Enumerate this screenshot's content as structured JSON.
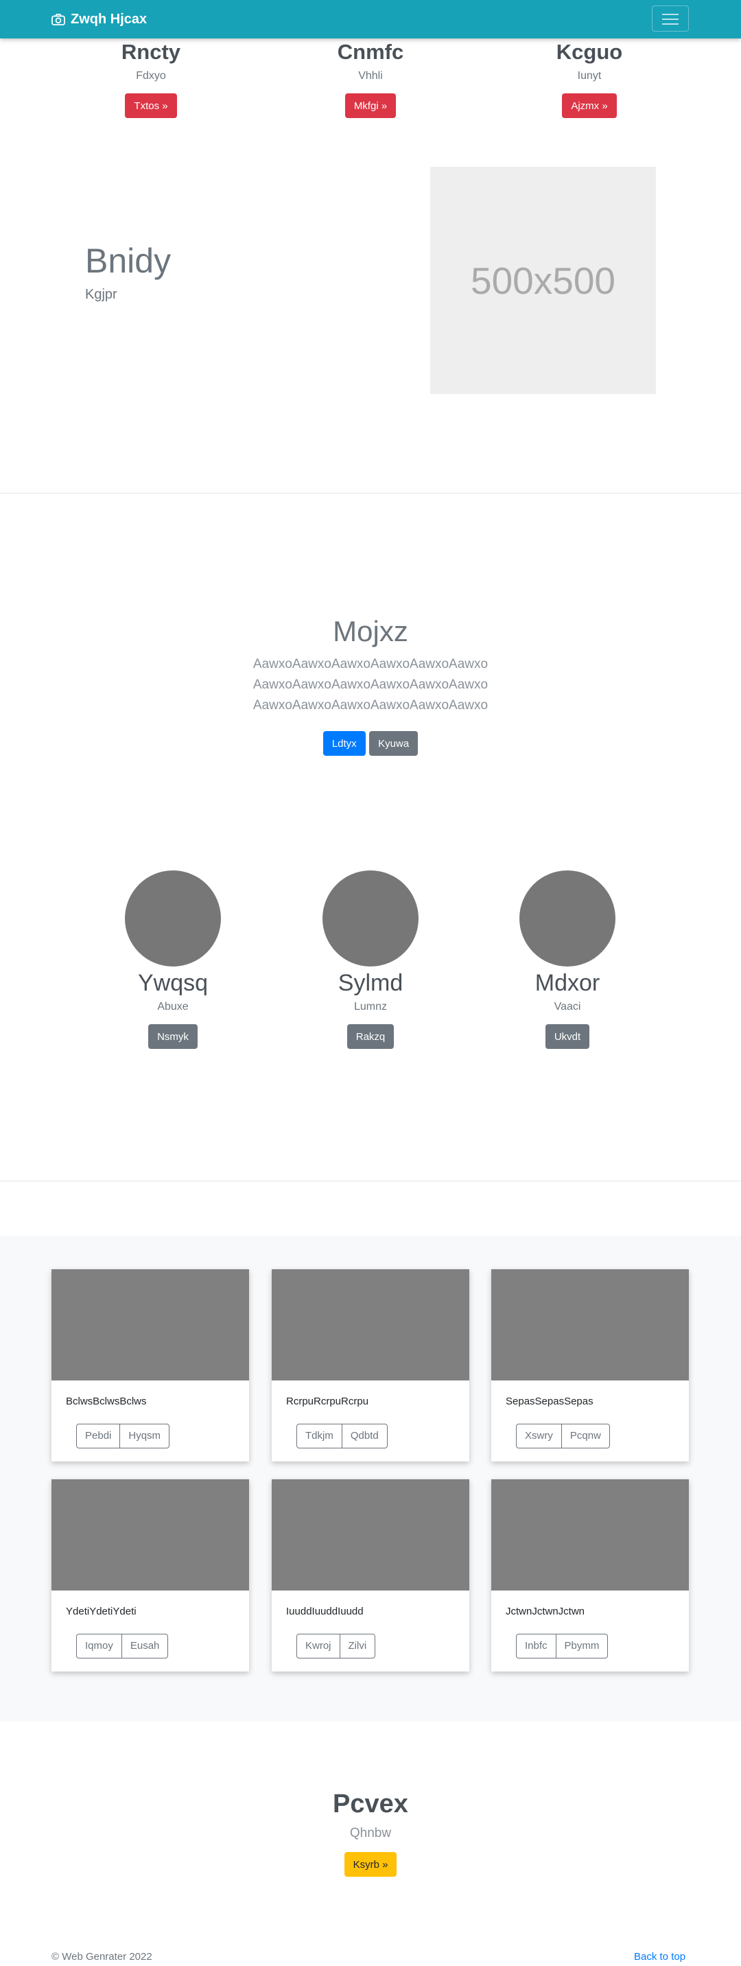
{
  "navbar": {
    "brand": "Zwqh Hjcax",
    "brand_icon": "camera-icon",
    "toggler_icon": "hamburger-icon"
  },
  "columns": [
    {
      "title": "Rncty",
      "subtitle": "Fdxyo",
      "button": "Txtos »"
    },
    {
      "title": "Cnmfc",
      "subtitle": "Vhhli",
      "button": "Mkfgi »"
    },
    {
      "title": "Kcguo",
      "subtitle": "Iunyt",
      "button": "Ajzmx »"
    }
  ],
  "feature": {
    "title": "Bnidy",
    "subtitle": "Kgjpr",
    "image_label": "500x500"
  },
  "jumbo": {
    "title": "Mojxz",
    "lines": [
      "AawxoAawxoAawxoAawxoAawxoAawxo",
      "AawxoAawxoAawxoAawxoAawxoAawxo",
      "AawxoAawxoAawxoAawxoAawxoAawxo"
    ],
    "primary": "Ldtyx",
    "secondary": "Kyuwa"
  },
  "team": [
    {
      "name": "Ywqsq",
      "role": "Abuxe",
      "button": "Nsmyk"
    },
    {
      "name": "Sylmd",
      "role": "Lumnz",
      "button": "Rakzq"
    },
    {
      "name": "Mdxor",
      "role": "Vaaci",
      "button": "Ukvdt"
    }
  ],
  "cards": [
    {
      "text": "BclwsBclwsBclws",
      "b1": "Pebdi",
      "b2": "Hyqsm"
    },
    {
      "text": "RcrpuRcrpuRcrpu",
      "b1": "Tdkjm",
      "b2": "Qdbtd"
    },
    {
      "text": "SepasSepasSepas",
      "b1": "Xswry",
      "b2": "Pcqnw"
    },
    {
      "text": "YdetiYdetiYdeti",
      "b1": "Iqmoy",
      "b2": "Eusah"
    },
    {
      "text": "IuuddIuuddIuudd",
      "b1": "Kwroj",
      "b2": "Zilvi"
    },
    {
      "text": "JctwnJctwnJctwn",
      "b1": "Inbfc",
      "b2": "Pbymm"
    }
  ],
  "cta": {
    "title": "Pcvex",
    "subtitle": "Qhnbw",
    "button": "Ksyrb »"
  },
  "footer": {
    "copyright": "© Web Genrater 2022",
    "back_to_top": "Back to top"
  },
  "colors": {
    "navbar": "#17a2b8",
    "danger": "#dc3545",
    "primary": "#007bff",
    "secondary": "#6c757d",
    "warning": "#ffc107"
  }
}
